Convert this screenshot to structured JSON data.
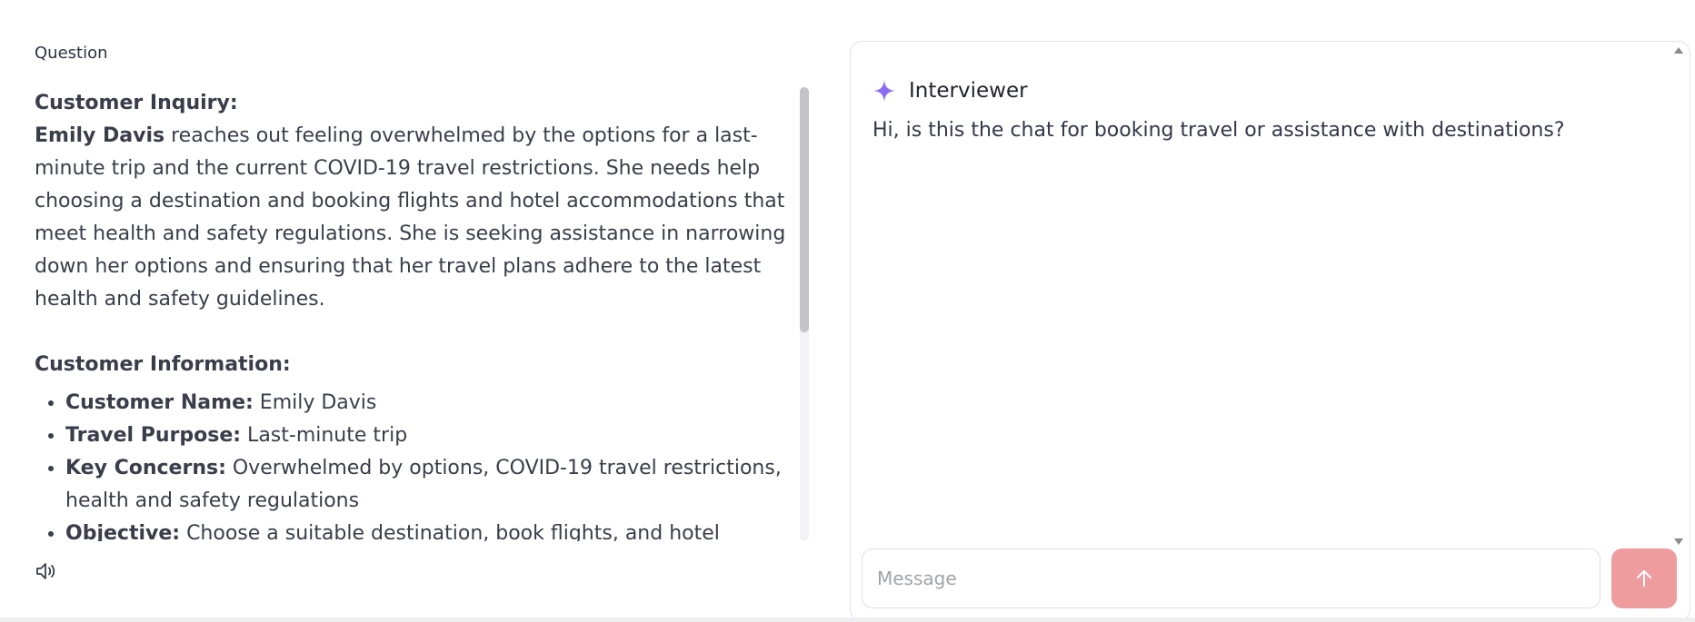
{
  "question_panel": {
    "label": "Question",
    "inquiry_heading": "Customer Inquiry:",
    "inquiry_name": "Emily Davis",
    "inquiry_text": " reaches out feeling overwhelmed by the options for a last-minute trip and the current COVID-19 travel restrictions. She needs help choosing a destination and booking flights and hotel accommodations that meet health and safety regulations. She is seeking assistance in narrowing down her options and ensuring that her travel plans adhere to the latest health and safety guidelines.",
    "info_heading": "Customer Information:",
    "info_items": [
      {
        "label": "Customer Name:",
        "value": " Emily Davis"
      },
      {
        "label": "Travel Purpose:",
        "value": " Last-minute trip"
      },
      {
        "label": "Key Concerns:",
        "value": " Overwhelmed by options, COVID-19 travel restrictions, health and safety regulations"
      },
      {
        "label": "Objective:",
        "value": " Choose a suitable destination, book flights, and hotel"
      }
    ],
    "speaker_icon": "speaker-icon"
  },
  "chat": {
    "sender": "Interviewer",
    "sender_icon": "sparkle-icon",
    "message": "Hi, is this the chat for booking travel or assistance with destinations?",
    "composer_placeholder": "Message",
    "send_icon": "arrow-up-icon"
  },
  "colors": {
    "accent_sparkle": "#8b6cf0",
    "send_button": "#ef9c9f"
  }
}
